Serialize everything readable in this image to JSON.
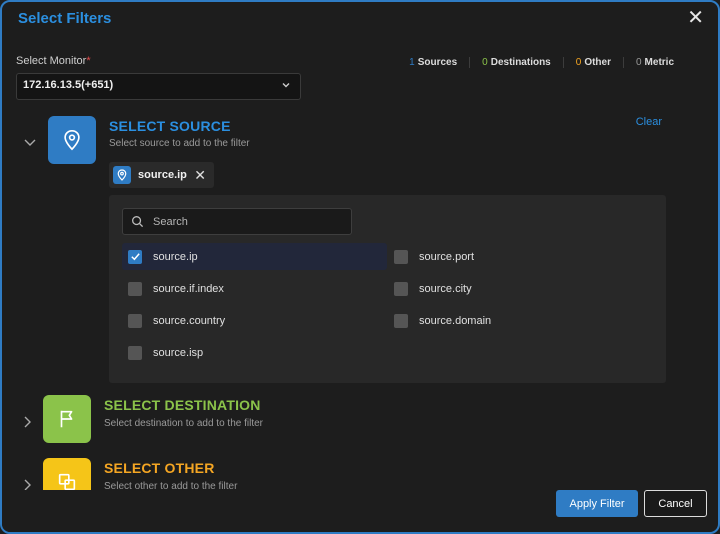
{
  "dialog": {
    "title": "Select Filters",
    "close_icon": "close-icon"
  },
  "monitor": {
    "label": "Select Monitor",
    "required_mark": "*",
    "value": "172.16.13.5(+651)"
  },
  "stats": [
    {
      "count": "1",
      "label": "Sources",
      "color": "#2f7cc4"
    },
    {
      "count": "0",
      "label": "Destinations",
      "color": "#8bc34a"
    },
    {
      "count": "0",
      "label": "Other",
      "color": "#f5a623"
    },
    {
      "count": "0",
      "label": "Metric",
      "color": "#9a9a9a"
    }
  ],
  "source_section": {
    "title": "SELECT SOURCE",
    "description": "Select source to add to the filter",
    "clear_label": "Clear",
    "color": "#2f7cc4",
    "selected_chip": "source.ip",
    "search_placeholder": "Search",
    "options": [
      {
        "label": "source.ip",
        "checked": true
      },
      {
        "label": "source.port",
        "checked": false
      },
      {
        "label": "source.if.index",
        "checked": false
      },
      {
        "label": "source.city",
        "checked": false
      },
      {
        "label": "source.country",
        "checked": false
      },
      {
        "label": "source.domain",
        "checked": false
      },
      {
        "label": "source.isp",
        "checked": false
      }
    ]
  },
  "destination_section": {
    "title": "SELECT DESTINATION",
    "description": "Select destination to add to the filter",
    "color": "#8bc34a"
  },
  "other_section": {
    "title": "SELECT OTHER",
    "description": "Select other to add to the filter",
    "color": "#f5c518"
  },
  "footer": {
    "apply_label": "Apply Filter",
    "cancel_label": "Cancel"
  }
}
